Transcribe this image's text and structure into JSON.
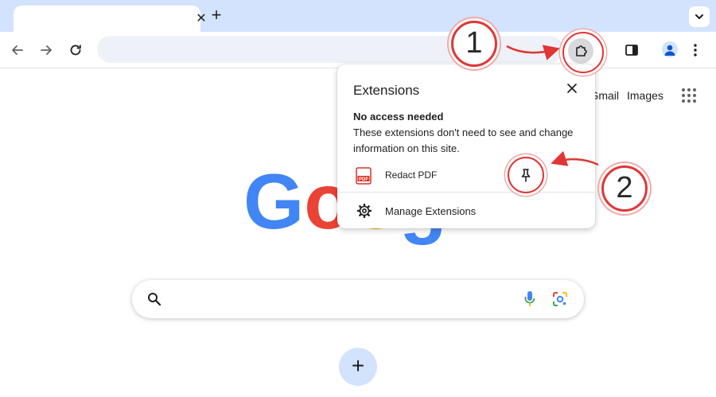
{
  "browser": {
    "tab": {
      "close_icon": "close-icon"
    },
    "new_tab_icon": "plus-icon",
    "omnibox": {
      "placeholder": ""
    }
  },
  "google_page": {
    "header_links": [
      "Gmail",
      "Images"
    ],
    "logo_text": "Google",
    "new_shortcut_icon": "plus-icon"
  },
  "extensions_popup": {
    "title": "Extensions",
    "section_heading": "No access needed",
    "section_description": "These extensions don't need to see and change information on this site.",
    "extension": {
      "name": "Redact PDF",
      "icon_label": "PDF"
    },
    "manage_label": "Manage Extensions"
  },
  "annotations": {
    "step1": "1",
    "step2": "2",
    "color": "#e03634"
  },
  "colors": {
    "tabstrip": "#d3e3fd",
    "accent": "#0b57d0"
  }
}
